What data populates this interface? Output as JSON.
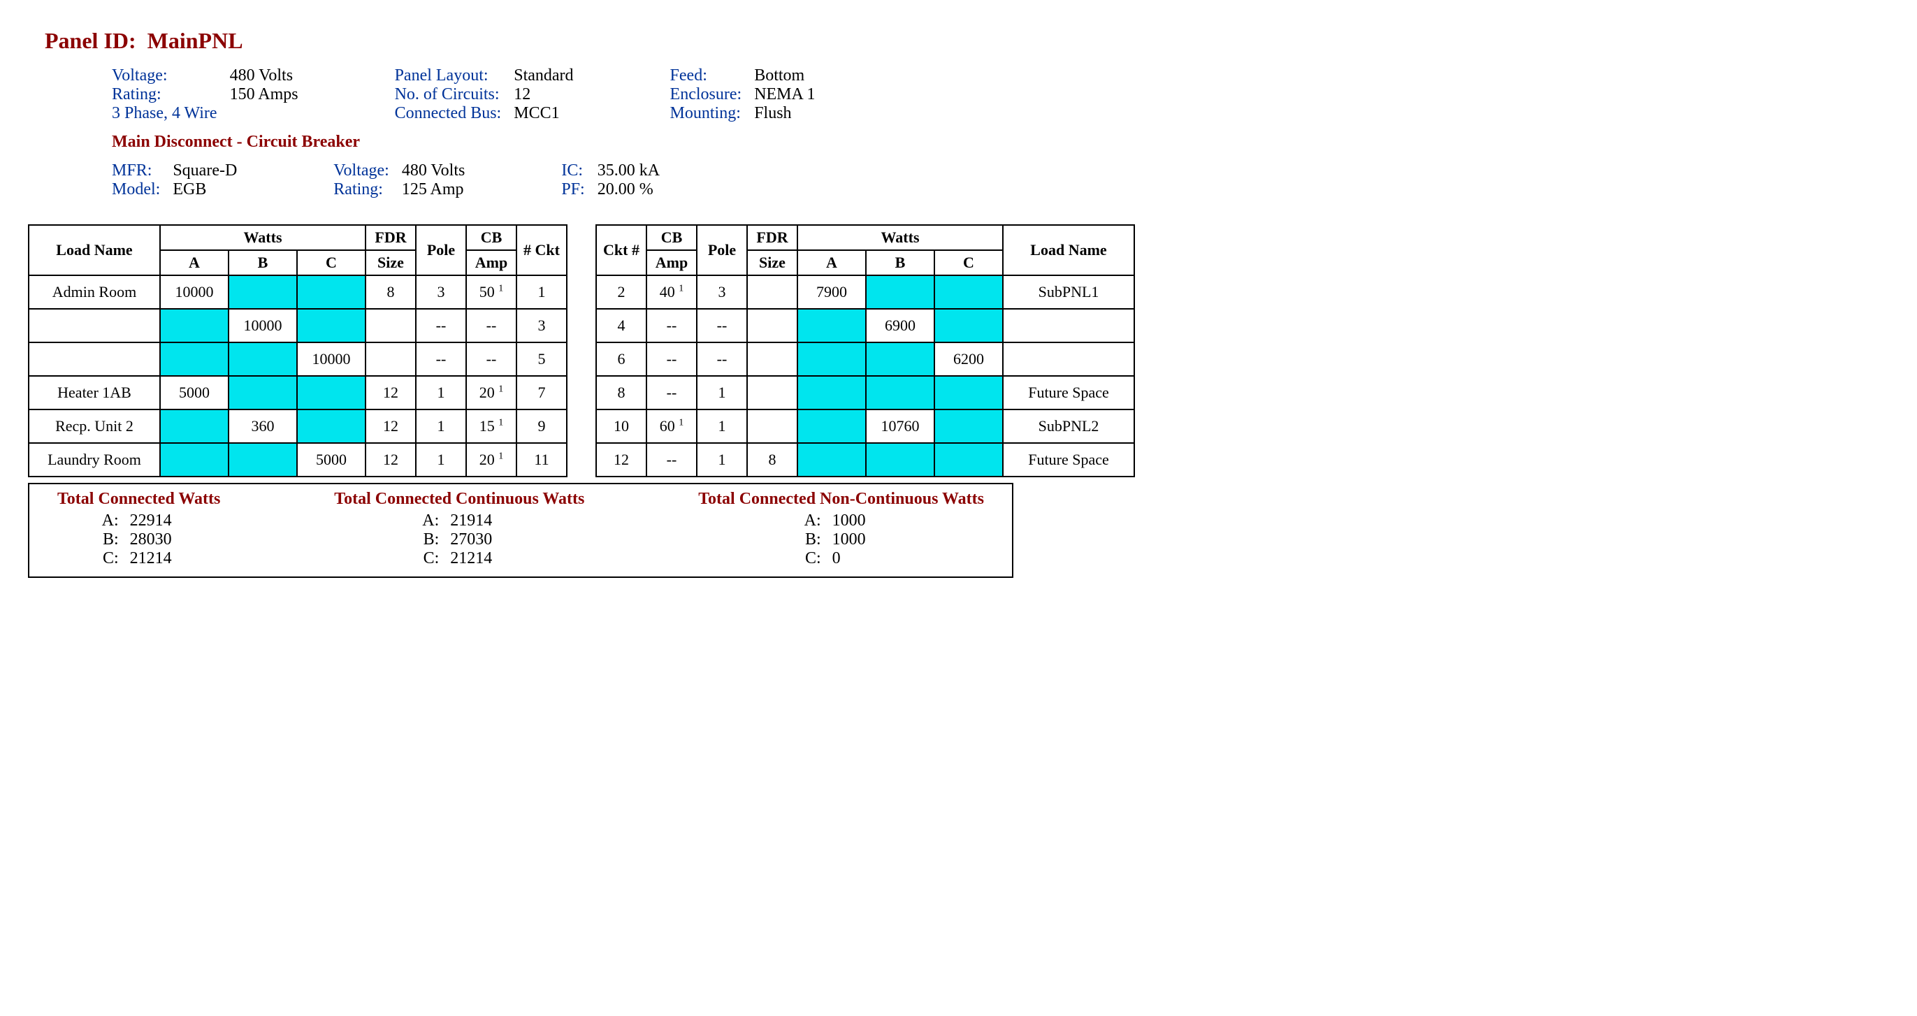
{
  "header": {
    "panel_id_label": "Panel ID:",
    "panel_id_value": "MainPNL",
    "col1": {
      "voltage_label": "Voltage:",
      "voltage_value": "480 Volts",
      "rating_label": "Rating:",
      "rating_value": "150 Amps",
      "phase_wire": "3 Phase, 4 Wire"
    },
    "col2": {
      "layout_label": "Panel Layout:",
      "layout_value": "Standard",
      "circuits_label": "No. of Circuits:",
      "circuits_value": "12",
      "bus_label": "Connected Bus:",
      "bus_value": "MCC1"
    },
    "col3": {
      "feed_label": "Feed:",
      "feed_value": "Bottom",
      "enclosure_label": "Enclosure:",
      "enclosure_value": "NEMA 1",
      "mounting_label": "Mounting:",
      "mounting_value": "Flush"
    },
    "main_disconnect_title": "Main Disconnect - Circuit Breaker",
    "md_col1": {
      "mfr_label": "MFR:",
      "mfr_value": "Square-D",
      "model_label": "Model:",
      "model_value": "EGB"
    },
    "md_col2": {
      "voltage_label": "Voltage:",
      "voltage_value": "480 Volts",
      "rating_label": "Rating:",
      "rating_value": "125 Amp"
    },
    "md_col3": {
      "ic_label": "IC:",
      "ic_value": "35.00 kA",
      "pf_label": "PF:",
      "pf_value": "20.00 %"
    }
  },
  "table_headers": {
    "load_name": "Load Name",
    "watts": "Watts",
    "A": "A",
    "B": "B",
    "C": "C",
    "fdr_size": "FDR",
    "fdr_size2": "Size",
    "pole": "Pole",
    "cb": "CB",
    "cb_amp": "Amp",
    "ckt_no": "# Ckt",
    "ckt_no2": "Ckt #"
  },
  "left_rows": [
    {
      "load": "Admin Room",
      "A": "10000",
      "B": "",
      "C": "",
      "fdr": "8",
      "pole": "3",
      "cb": "50",
      "cb_sup": "1",
      "ckt": "1",
      "hlA": true,
      "hlB": true,
      "hlC": true
    },
    {
      "load": "",
      "A": "",
      "B": "10000",
      "C": "",
      "fdr": "",
      "pole": "--",
      "cb": "--",
      "cb_sup": "",
      "ckt": "3",
      "hlA": true,
      "hlB": true,
      "hlC": true
    },
    {
      "load": "",
      "A": "",
      "B": "",
      "C": "10000",
      "fdr": "",
      "pole": "--",
      "cb": "--",
      "cb_sup": "",
      "ckt": "5",
      "hlA": true,
      "hlB": true,
      "hlC": true
    },
    {
      "load": "Heater 1AB",
      "A": "5000",
      "B": "",
      "C": "",
      "fdr": "12",
      "pole": "1",
      "cb": "20",
      "cb_sup": "1",
      "ckt": "7",
      "hlA": true,
      "hlB": true,
      "hlC": true
    },
    {
      "load": "Recp. Unit 2",
      "A": "",
      "B": "360",
      "C": "",
      "fdr": "12",
      "pole": "1",
      "cb": "15",
      "cb_sup": "1",
      "ckt": "9",
      "hlA": true,
      "hlB": true,
      "hlC": true
    },
    {
      "load": "Laundry Room",
      "A": "",
      "B": "",
      "C": "5000",
      "fdr": "12",
      "pole": "1",
      "cb": "20",
      "cb_sup": "1",
      "ckt": "11",
      "hlA": true,
      "hlB": true,
      "hlC": true
    }
  ],
  "right_rows": [
    {
      "ckt": "2",
      "cb": "40",
      "cb_sup": "1",
      "pole": "3",
      "fdr": "",
      "A": "7900",
      "B": "",
      "C": "",
      "load": "SubPNL1",
      "hlA": true,
      "hlB": true,
      "hlC": true
    },
    {
      "ckt": "4",
      "cb": "--",
      "cb_sup": "",
      "pole": "--",
      "fdr": "",
      "A": "",
      "B": "6900",
      "C": "",
      "load": "",
      "hlA": true,
      "hlB": true,
      "hlC": true
    },
    {
      "ckt": "6",
      "cb": "--",
      "cb_sup": "",
      "pole": "--",
      "fdr": "",
      "A": "",
      "B": "",
      "C": "6200",
      "load": "",
      "hlA": true,
      "hlB": true,
      "hlC": true
    },
    {
      "ckt": "8",
      "cb": "--",
      "cb_sup": "",
      "pole": "1",
      "fdr": "",
      "A": "",
      "B": "",
      "C": "",
      "load": "Future Space",
      "hlA": true,
      "hlB": true,
      "hlC": true
    },
    {
      "ckt": "10",
      "cb": "60",
      "cb_sup": "1",
      "pole": "1",
      "fdr": "",
      "A": "",
      "B": "10760",
      "C": "",
      "load": "SubPNL2",
      "hlA": true,
      "hlB": true,
      "hlC": true
    },
    {
      "ckt": "12",
      "cb": "--",
      "cb_sup": "",
      "pole": "1",
      "fdr": "8",
      "A": "",
      "B": "",
      "C": "",
      "load": "Future Space",
      "hlA": true,
      "hlB": true,
      "hlC": true
    }
  ],
  "totals": {
    "connected": {
      "title": "Total Connected Watts",
      "A_l": "A:",
      "A": "22914",
      "B_l": "B:",
      "B": "28030",
      "C_l": "C:",
      "C": "21214"
    },
    "continuous": {
      "title": "Total Connected Continuous Watts",
      "A_l": "A:",
      "A": "21914",
      "B_l": "B:",
      "B": "27030",
      "C_l": "C:",
      "C": "21214"
    },
    "noncontinuous": {
      "title": "Total Connected Non-Continuous Watts",
      "A_l": "A:",
      "A": "1000",
      "B_l": "B:",
      "B": "1000",
      "C_l": "C:",
      "C": "0"
    }
  }
}
